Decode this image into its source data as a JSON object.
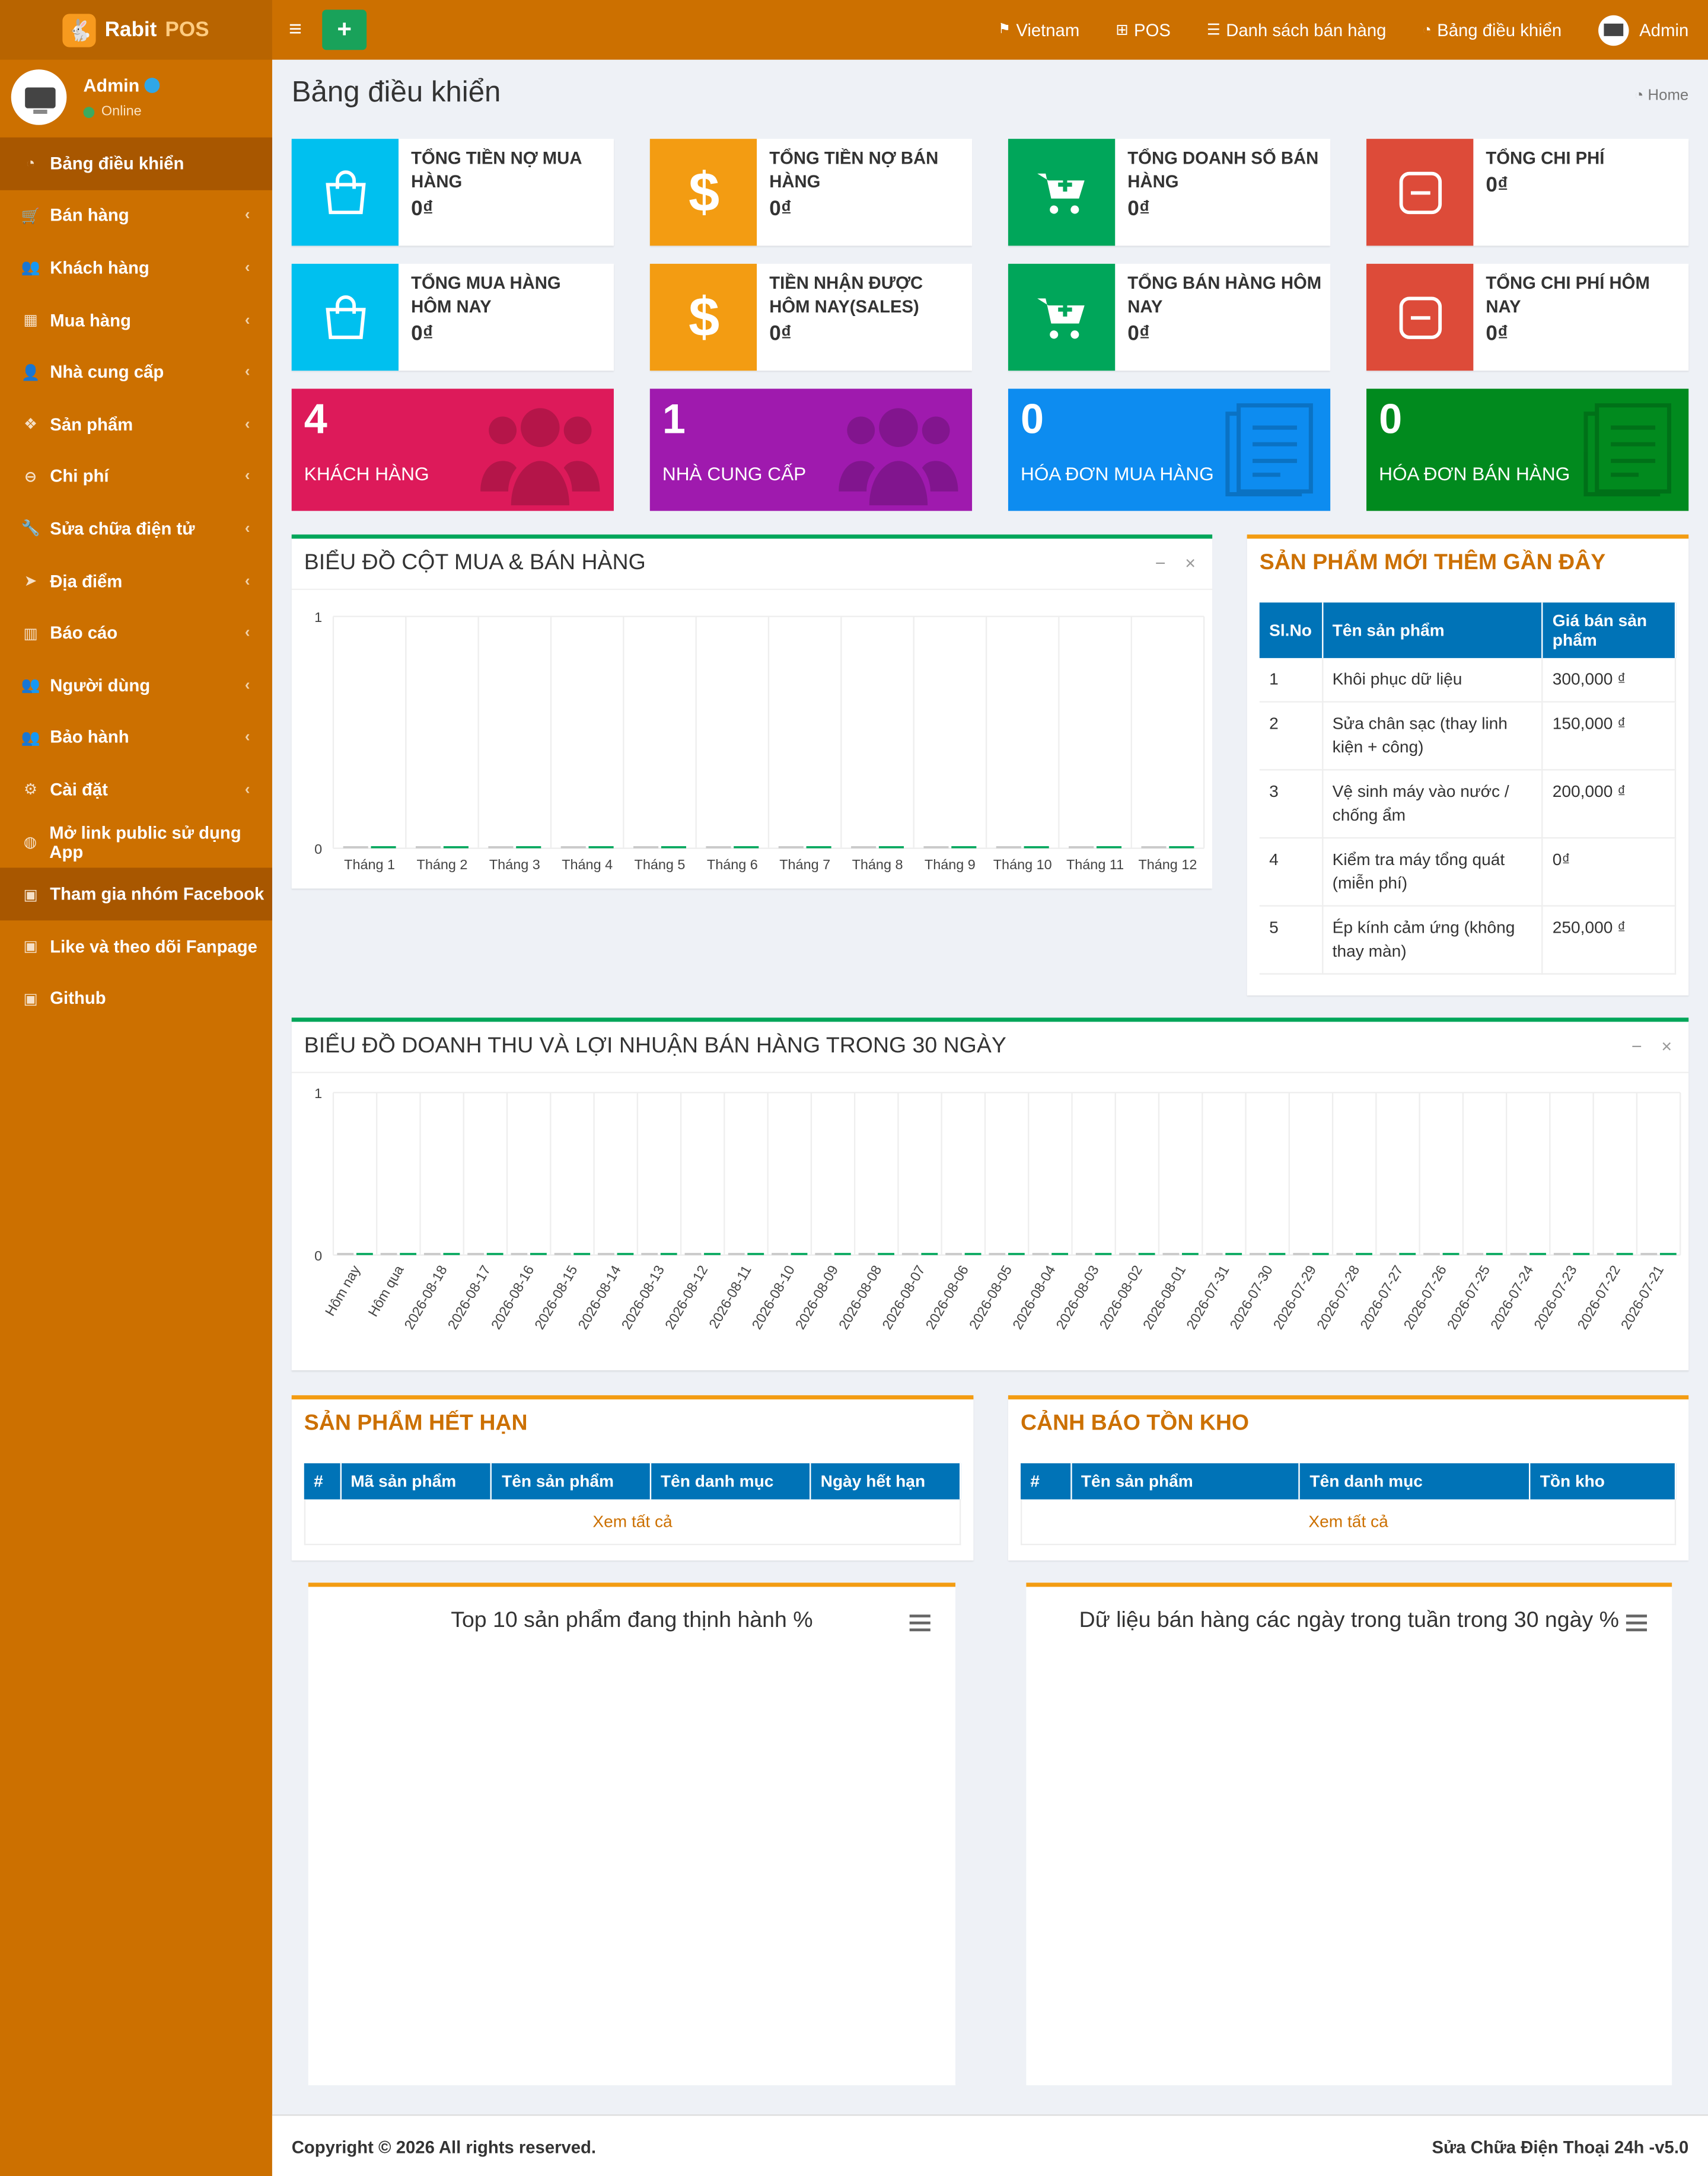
{
  "brand": {
    "name": "Rabit",
    "suffix": "POS"
  },
  "user": {
    "name": "Admin",
    "status": "Online"
  },
  "sidebar": {
    "items": [
      {
        "label": "Bảng điều khiển",
        "icon": "dashboard-icon",
        "chev": false
      },
      {
        "label": "Bán hàng",
        "icon": "cart-icon",
        "chev": true
      },
      {
        "label": "Khách hàng",
        "icon": "users-icon",
        "chev": true
      },
      {
        "label": "Mua hàng",
        "icon": "grid-icon",
        "chev": true
      },
      {
        "label": "Nhà cung cấp",
        "icon": "user-plus-icon",
        "chev": true
      },
      {
        "label": "Sản phẩm",
        "icon": "cubes-icon",
        "chev": true
      },
      {
        "label": "Chi phí",
        "icon": "minus-circle-icon",
        "chev": true
      },
      {
        "label": "Sửa chữa điện tử",
        "icon": "wrench-icon",
        "chev": true
      },
      {
        "label": "Địa điểm",
        "icon": "send-icon",
        "chev": true
      },
      {
        "label": "Báo cáo",
        "icon": "bar-chart-icon",
        "chev": true
      },
      {
        "label": "Người dùng",
        "icon": "users-icon",
        "chev": true
      },
      {
        "label": "Bảo hành",
        "icon": "users-icon",
        "chev": true
      },
      {
        "label": "Cài đặt",
        "icon": "cogs-icon",
        "chev": true
      },
      {
        "label": "Mở link public sử dụng App",
        "icon": "globe-icon",
        "chev": false
      },
      {
        "label": "Tham gia nhóm Facebook",
        "icon": "briefcase-icon",
        "chev": false
      },
      {
        "label": "Like và theo dõi Fanpage",
        "icon": "briefcase-icon",
        "chev": false
      },
      {
        "label": "Github",
        "icon": "briefcase-icon",
        "chev": false
      }
    ]
  },
  "topbar": {
    "language": "Vietnam",
    "pos": "POS",
    "sales_list": "Danh sách bán hàng",
    "dashboard": "Bảng điều khiển",
    "user": "Admin"
  },
  "page": {
    "title": "Bảng điều khiển",
    "breadcrumb": "Home"
  },
  "info_boxes": [
    {
      "label": "TỔNG TIỀN NỢ MUA HÀNG",
      "value": "0₫",
      "color": "#00c0ef",
      "icon": "shopping-bag-icon"
    },
    {
      "label": "TỔNG TIỀN NỢ BÁN HÀNG",
      "value": "0₫",
      "color": "#f39c12",
      "icon": "dollar-icon"
    },
    {
      "label": "TỔNG DOANH SỐ BÁN HÀNG",
      "value": "0₫",
      "color": "#00a65a",
      "icon": "cart-plus-icon"
    },
    {
      "label": "TỔNG CHI PHÍ",
      "value": "0₫",
      "color": "#dd4b39",
      "icon": "minus-square-icon"
    },
    {
      "label": "TỔNG MUA HÀNG HÔM NAY",
      "value": "0₫",
      "color": "#00c0ef",
      "icon": "shopping-bag-icon"
    },
    {
      "label": "TIỀN NHẬN ĐƯỢC HÔM NAY(SALES)",
      "value": "0₫",
      "color": "#f39c12",
      "icon": "dollar-icon"
    },
    {
      "label": "TỔNG BÁN HÀNG HÔM NAY",
      "value": "0₫",
      "color": "#00a65a",
      "icon": "cart-plus-icon"
    },
    {
      "label": "TỔNG CHI PHÍ HÔM NAY",
      "value": "0₫",
      "color": "#dd4b39",
      "icon": "minus-square-icon"
    }
  ],
  "stat_boxes": [
    {
      "value": "4",
      "label": "KHÁCH HÀNG",
      "color": "#dd1a5a",
      "icon": "users-icon"
    },
    {
      "value": "1",
      "label": "NHÀ CUNG CẤP",
      "color": "#9f1aae",
      "icon": "users-icon"
    },
    {
      "value": "0",
      "label": "HÓA ĐƠN MUA HÀNG",
      "color": "#0d8cf0",
      "icon": "invoice-icon"
    },
    {
      "value": "0",
      "label": "HÓA ĐƠN BÁN HÀNG",
      "color": "#018a1e",
      "icon": "invoice-icon"
    }
  ],
  "bar_panel": {
    "title": "BIỂU ĐỒ CỘT MUA & BÁN HÀNG"
  },
  "line_panel": {
    "title": "BIỂU ĐỒ DOANH THU VÀ LỢI NHUẬN BÁN HÀNG TRONG 30 NGÀY"
  },
  "recent_products": {
    "title": "SẢN PHẨM MỚI THÊM GẦN ĐÂY",
    "headers": [
      "Sl.No",
      "Tên sản phẩm",
      "Giá bán sản phẩm"
    ],
    "rows": [
      [
        "1",
        "Khôi phục dữ liệu",
        "300,000 ₫"
      ],
      [
        "2",
        "Sửa chân sạc (thay linh kiện + công)",
        "150,000 ₫"
      ],
      [
        "3",
        "Vệ sinh máy vào nước / chống ẩm",
        "200,000 ₫"
      ],
      [
        "4",
        "Kiểm tra máy tổng quát (miễn phí)",
        "0₫"
      ],
      [
        "5",
        "Ép kính cảm ứng (không thay màn)",
        "250,000 ₫"
      ]
    ]
  },
  "expired": {
    "title": "SẢN PHẨM HẾT HẠN",
    "headers": [
      "#",
      "Mã sản phẩm",
      "Tên sản phẩm",
      "Tên danh mục",
      "Ngày hết hạn"
    ],
    "view_all": "Xem tất cả"
  },
  "stock": {
    "title": "CẢNH BÁO TỒN KHO",
    "headers": [
      "#",
      "Tên sản phẩm",
      "Tên danh mục",
      "Tồn kho"
    ],
    "view_all": "Xem tất cả"
  },
  "top_products": {
    "title": "Top 10 sản phẩm đang thịnh hành %"
  },
  "weekday_sales": {
    "title": "Dữ liệu bán hàng các ngày trong tuần trong 30 ngày %"
  },
  "footer": {
    "copyright": "Copyright © 2026 All rights reserved.",
    "version": "Sửa Chữa Điện Thoại 24h -v5.0"
  },
  "chart_data": [
    {
      "type": "bar",
      "title": "",
      "categories": [
        "Tháng 1",
        "Tháng 2",
        "Tháng 3",
        "Tháng 4",
        "Tháng 5",
        "Tháng 6",
        "Tháng 7",
        "Tháng 8",
        "Tháng 9",
        "Tháng 10",
        "Tháng 11",
        "Tháng 12"
      ],
      "series": [
        {
          "values": [
            0,
            0,
            0,
            0,
            0,
            0,
            0,
            0,
            0,
            0,
            0,
            0
          ],
          "color": "#c8c8c8"
        },
        {
          "values": [
            0,
            0,
            0,
            0,
            0,
            0,
            0,
            0,
            0,
            0,
            0,
            0
          ],
          "color": "#00a65a"
        }
      ],
      "ylim": [
        0,
        1
      ],
      "yticks": [
        "0",
        "1"
      ],
      "grid": true
    },
    {
      "type": "bar",
      "title": "",
      "categories": [
        "Hôm nay",
        "Hôm qua",
        "2026-08-18",
        "2026-08-17",
        "2026-08-16",
        "2026-08-15",
        "2026-08-14",
        "2026-08-13",
        "2026-08-12",
        "2026-08-11",
        "2026-08-10",
        "2026-08-09",
        "2026-08-08",
        "2026-08-07",
        "2026-08-06",
        "2026-08-05",
        "2026-08-04",
        "2026-08-03",
        "2026-08-02",
        "2026-08-01",
        "2026-07-31",
        "2026-07-30",
        "2026-07-29",
        "2026-07-28",
        "2026-07-27",
        "2026-07-26",
        "2026-07-25",
        "2026-07-24",
        "2026-07-23",
        "2026-07-22",
        "2026-07-21"
      ],
      "series": [
        {
          "values": [
            0,
            0,
            0,
            0,
            0,
            0,
            0,
            0,
            0,
            0,
            0,
            0,
            0,
            0,
            0,
            0,
            0,
            0,
            0,
            0,
            0,
            0,
            0,
            0,
            0,
            0,
            0,
            0,
            0,
            0,
            0
          ],
          "color": "#c8c8c8"
        },
        {
          "values": [
            0,
            0,
            0,
            0,
            0,
            0,
            0,
            0,
            0,
            0,
            0,
            0,
            0,
            0,
            0,
            0,
            0,
            0,
            0,
            0,
            0,
            0,
            0,
            0,
            0,
            0,
            0,
            0,
            0,
            0,
            0
          ],
          "color": "#00a65a"
        }
      ],
      "ylim": [
        0,
        1
      ],
      "yticks": [
        "0",
        "1"
      ],
      "grid": true
    }
  ]
}
